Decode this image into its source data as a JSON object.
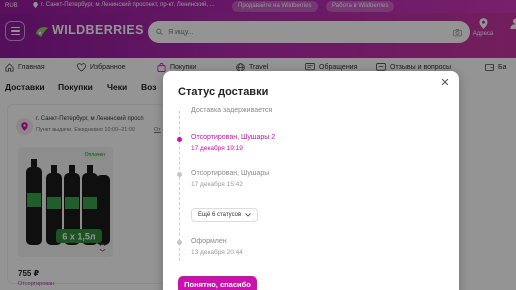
{
  "colors": {
    "brand": "#cb11ab",
    "header_gradient_start": "#8e1a9c",
    "header_gradient_end": "#c7359f",
    "overlay": "rgba(0,0,0,0.42)"
  },
  "topbar": {
    "currency": "RUB",
    "location": "г. Санкт-Петербург, м Ленинский проспект, пр-кт. Ленинский, ...",
    "sell_link": "Продавайте на Wildberries",
    "work_link": "Работа в Wildberries"
  },
  "header": {
    "logo": "WILDBERRIES",
    "search_placeholder": "Я ищу...",
    "address_label": "Адреса",
    "icons": [
      "menu-icon",
      "location-icon",
      "camera-icon",
      "user-icon"
    ]
  },
  "nav": {
    "items": [
      {
        "label": "Главная",
        "icon": "home-icon"
      },
      {
        "label": "Избранное",
        "icon": "heart-icon"
      },
      {
        "label": "Покупки",
        "icon": "bag-icon"
      },
      {
        "label": "Travel",
        "icon": "globe-icon"
      },
      {
        "label": "Обращения",
        "icon": "chat-icon"
      },
      {
        "label": "Отзывы и вопросы",
        "icon": "reviews-icon"
      },
      {
        "label": "Ба",
        "icon": "wallet-icon"
      }
    ]
  },
  "tabs": [
    "Доставки",
    "Покупки",
    "Чеки",
    "Воз"
  ],
  "pickup": {
    "address": "г. Санкт-Петербург, м Ленинский просп",
    "hours": "Пункт выдачи. Ежедневно 10:00–21:00",
    "hours_extra": "От",
    "product_badge": "Оплачен",
    "pack_label": "6 x 1,5л",
    "price": "755 ₽",
    "status": "Отсортирован"
  },
  "modal": {
    "title": "Статус доставки",
    "delay_note": "Доставка задерживается",
    "events": [
      {
        "title": "Отсортирован, Шушары 2",
        "date": "17 декабря 19:19",
        "active": true
      },
      {
        "title": "Отсортирован, Шушары",
        "date": "17 декабря 15:42",
        "active": false
      },
      {
        "title": "Оформлен",
        "date": "13 декабря 20:44",
        "active": false
      }
    ],
    "more_label": "Ещё 6 статусов",
    "ok_button": "Понятно, спасибо"
  }
}
